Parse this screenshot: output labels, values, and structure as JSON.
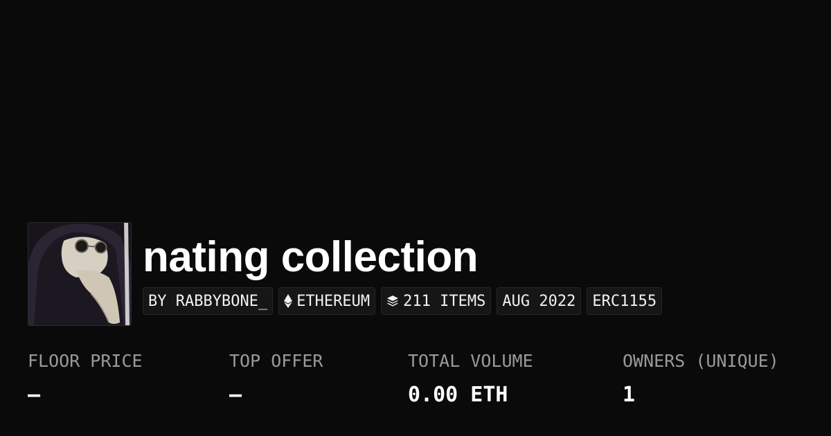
{
  "collection": {
    "title": "nating collection",
    "avatar_alt": "plague-doctor-mask-image"
  },
  "tags": {
    "creator": "BY RABBYBONE_",
    "chain": "ETHEREUM",
    "chain_icon": "ethereum-icon",
    "items": "211 ITEMS",
    "items_icon": "layers-icon",
    "date": "AUG 2022",
    "standard": "ERC1155"
  },
  "stats": {
    "floor_price": {
      "label": "FLOOR PRICE",
      "value": "—"
    },
    "top_offer": {
      "label": "TOP OFFER",
      "value": "—"
    },
    "total_volume": {
      "label": "TOTAL VOLUME",
      "value": "0.00 ETH"
    },
    "owners": {
      "label": "OWNERS (UNIQUE)",
      "value": "1"
    }
  },
  "colors": {
    "background": "#0a0a0a",
    "tag_background": "#161616",
    "label_gray": "#9a9a9a",
    "text": "#ffffff"
  }
}
